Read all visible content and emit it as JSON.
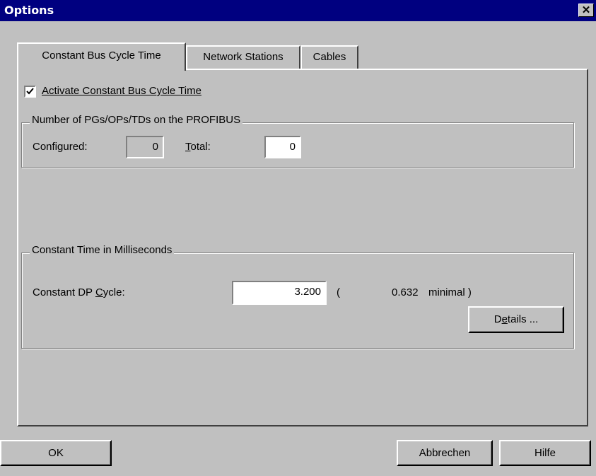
{
  "window": {
    "title": "Options",
    "close_glyph": "✕"
  },
  "tabs": [
    {
      "label": "Constant Bus Cycle Time"
    },
    {
      "label": "Network Stations"
    },
    {
      "label": "Cables"
    }
  ],
  "activate": {
    "label": "Activate Constant Bus Cycle Time",
    "checked": true
  },
  "stations": {
    "legend": "Number of PGs/OPs/TDs on the PROFIBUS",
    "configured_label": "Configured:",
    "configured_value": "0",
    "total_label": "Total:",
    "total_value": "0"
  },
  "constant_time": {
    "legend": "Constant Time in Milliseconds",
    "cycle_label": "Constant DP Cycle:",
    "cycle_value": "3.200",
    "open_paren": "(",
    "minimal_value": "0.632",
    "minimal_text": "minimal )",
    "details_button": "Details ..."
  },
  "buttons": {
    "ok": "OK",
    "cancel": "Abbrechen",
    "help": "Hilfe"
  }
}
